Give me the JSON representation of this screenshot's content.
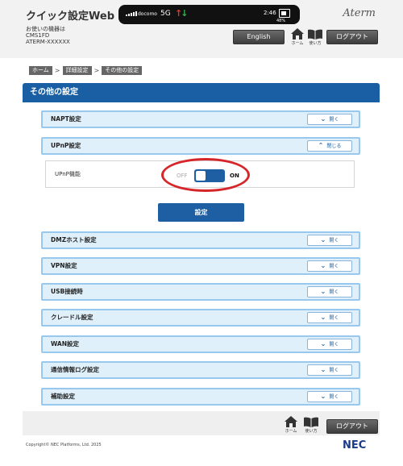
{
  "header": {
    "app_title": "クイック設定Web",
    "device_caption": "お使いの機器は",
    "device_model": "CMS1FD",
    "device_name": "ATERM-XXXXXX",
    "brand": "Aterm",
    "english_label": "English",
    "logout_label": "ログアウト",
    "home_label": "ホーム",
    "help_label": "使い方"
  },
  "status_bar": {
    "carrier": "docomo",
    "network": "5G",
    "clock": "2:46",
    "battery": "48%"
  },
  "breadcrumb": [
    "ホーム",
    "詳細設定",
    "その他の設定"
  ],
  "breadcrumb_sep": ">",
  "page_title": "その他の設定",
  "open_label": "開く",
  "close_label": "閉じる",
  "panels": {
    "napt": "NAPT設定",
    "upnp": "UPnP設定",
    "dmz": "DMZホスト設定",
    "vpn": "VPN設定",
    "usb": "USB接続時",
    "cradle": "クレードル設定",
    "wan": "WAN設定",
    "log": "通信情報ログ設定",
    "aux": "補助設定"
  },
  "upnp": {
    "function_label": "UPnP機能",
    "off": "OFF",
    "on": "ON",
    "enabled": true
  },
  "set_button": "設定",
  "footer": {
    "home_label": "ホーム",
    "help_label": "使い方",
    "logout_label": "ログアウト",
    "copyright": "Copyright© NEC Platforms, Ltd. 2025",
    "logo": "NEC"
  },
  "colors": {
    "accent": "#1e5fa4",
    "panel_bg": "#dff0fb",
    "panel_border": "#99c8ee",
    "highlight": "#d7262a"
  }
}
